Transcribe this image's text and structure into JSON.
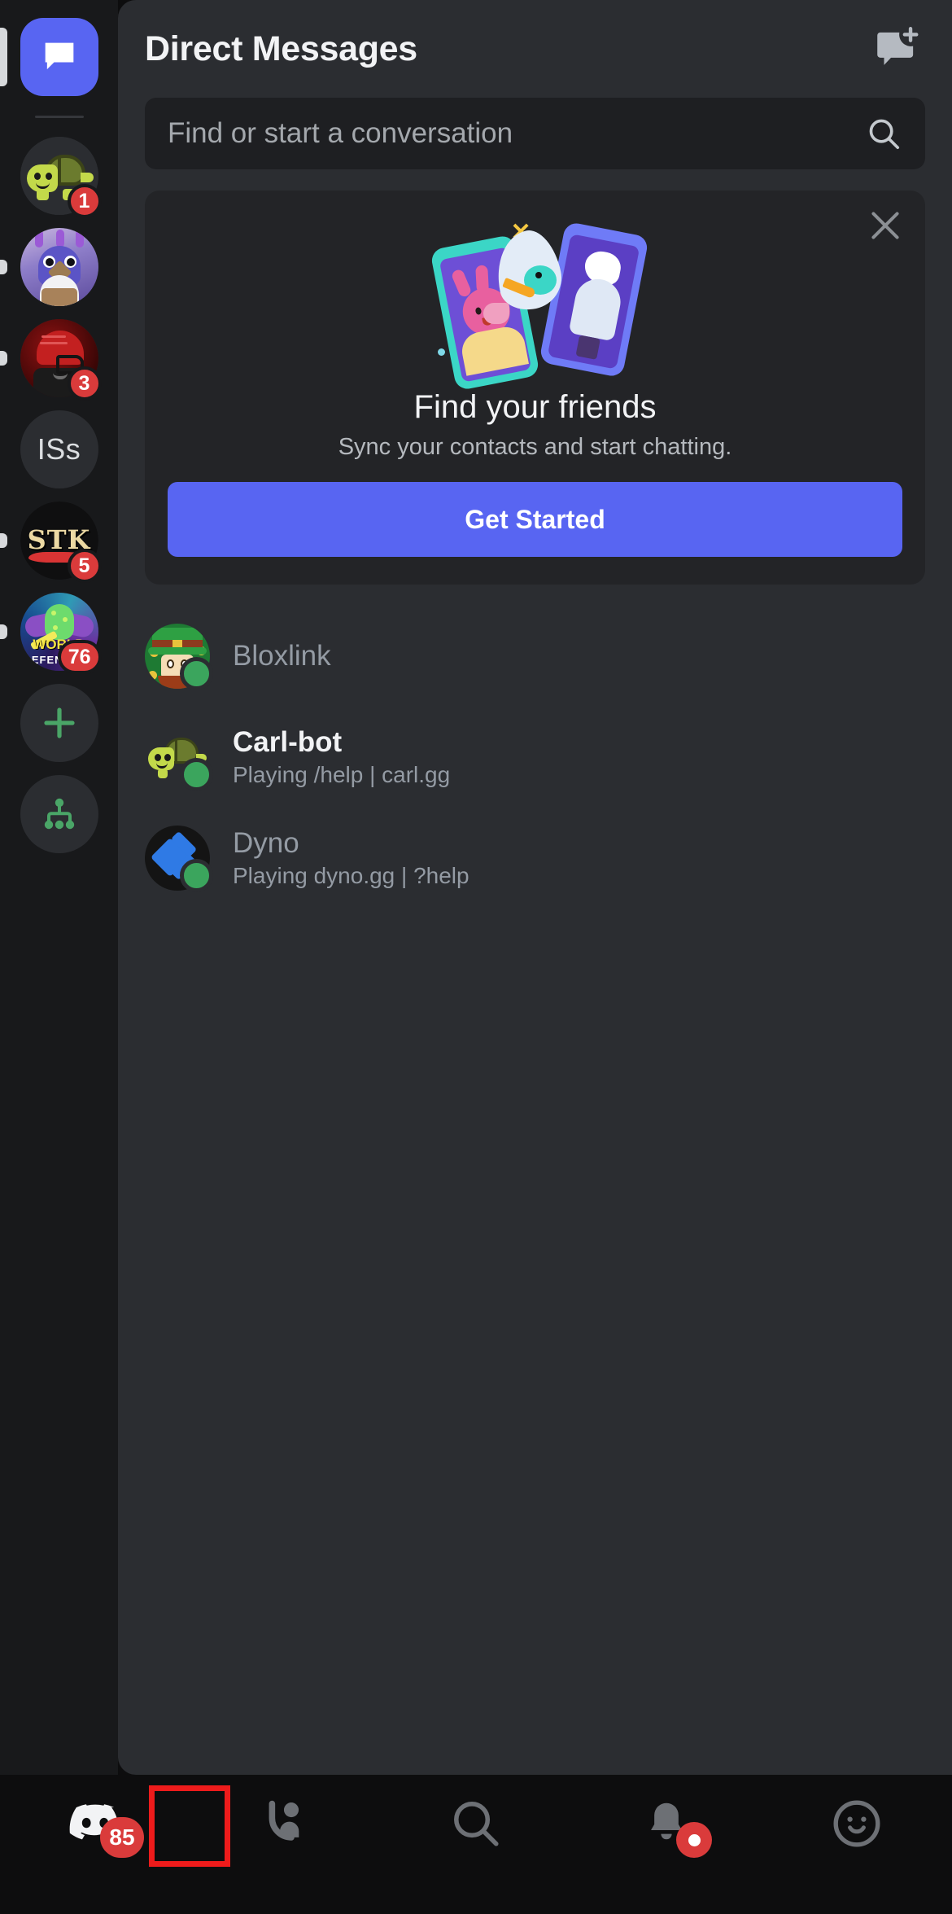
{
  "app": {
    "name": "Discord",
    "theme_bg": "#0d0d0e",
    "panel_bg": "#2b2d31",
    "accent": "#5865f2",
    "badge_red": "#da3b3b",
    "online_green": "#3ba55d"
  },
  "server_rail": {
    "items": [
      {
        "id": "home",
        "type": "home",
        "label": "Direct Messages",
        "selected": true,
        "badge": null,
        "unread": false
      },
      {
        "id": "turtle",
        "type": "emoji",
        "label": "Turtle Server",
        "selected": false,
        "badge": "1",
        "unread": false
      },
      {
        "id": "bird",
        "type": "image",
        "label": "Penguin Server",
        "selected": false,
        "badge": null,
        "unread": true
      },
      {
        "id": "football",
        "type": "image",
        "label": "Football Server",
        "selected": false,
        "badge": "3",
        "unread": true
      },
      {
        "id": "iss",
        "type": "initials",
        "label": "ISs",
        "selected": false,
        "badge": null,
        "unread": false
      },
      {
        "id": "stk",
        "type": "image",
        "label": "STK",
        "selected": false,
        "badge": "5",
        "unread": true
      },
      {
        "id": "world-defenders",
        "type": "image",
        "label": "World Defenders",
        "selected": false,
        "badge": "76",
        "unread": true
      },
      {
        "id": "add-server",
        "type": "action",
        "label": "Add a Server",
        "selected": false,
        "badge": null,
        "unread": false
      },
      {
        "id": "explore",
        "type": "action",
        "label": "Explore Public Servers",
        "selected": false,
        "badge": null,
        "unread": false
      }
    ],
    "stk_text": "STK",
    "wd_text": "WORLD",
    "wd_text2": "DEFENDERS",
    "iss_initials": "ISs"
  },
  "header": {
    "title": "Direct Messages",
    "new_dm_icon": "new-message-icon"
  },
  "search": {
    "placeholder": "Find or start a conversation",
    "value": "",
    "icon": "search-icon"
  },
  "promo": {
    "title": "Find your friends",
    "subtitle": "Sync your contacts and start chatting.",
    "button_label": "Get Started",
    "close_icon": "close-icon",
    "illustration": "two-phones-bunny-and-bird"
  },
  "dm_list": [
    {
      "name": "Bloxlink",
      "subtitle": "",
      "status": "online",
      "unread": false,
      "avatar": "bloxlink-leprechaun-avatar"
    },
    {
      "name": "Carl-bot",
      "subtitle": "Playing /help | carl.gg",
      "status": "online",
      "unread": true,
      "avatar": "carlbot-turtle-avatar"
    },
    {
      "name": "Dyno",
      "subtitle": "Playing dyno.gg | ?help",
      "status": "online",
      "unread": false,
      "avatar": "dyno-logo-avatar"
    }
  ],
  "bottom_nav": [
    {
      "id": "servers",
      "icon": "discord-logo-icon",
      "badge": "85",
      "dot": false,
      "active": false
    },
    {
      "id": "friends",
      "icon": "friends-icon",
      "badge": null,
      "dot": false,
      "active": true
    },
    {
      "id": "search",
      "icon": "search-icon",
      "badge": null,
      "dot": false,
      "active": false
    },
    {
      "id": "notifications",
      "icon": "bell-icon",
      "badge": null,
      "dot": true,
      "active": false
    },
    {
      "id": "profile",
      "icon": "smiley-face-icon",
      "badge": null,
      "dot": false,
      "active": false
    }
  ],
  "annotation": {
    "highlight_target": "friends",
    "highlight_color": "#ee1b1b"
  }
}
